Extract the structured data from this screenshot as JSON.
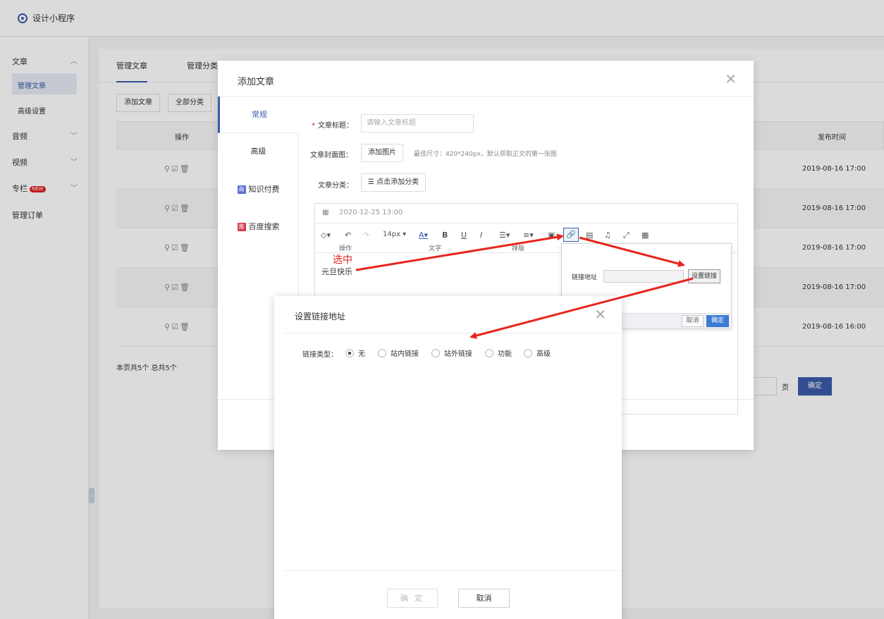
{
  "app": {
    "title": "设计小程序"
  },
  "sidebar": {
    "groups": [
      {
        "label": "文章",
        "chevron": "^"
      },
      {
        "label": "音频",
        "chevron": "v"
      },
      {
        "label": "视频",
        "chevron": "v"
      },
      {
        "label": "专栏",
        "chevron": "v",
        "badge": "NEW"
      },
      {
        "label": "管理订单"
      }
    ],
    "sub_items": [
      {
        "label": "管理文章",
        "active": true
      },
      {
        "label": "高级设置",
        "active": false
      }
    ]
  },
  "main": {
    "tabs": [
      {
        "label": "管理文章"
      },
      {
        "label": "管理分类"
      }
    ],
    "actions": {
      "add": "添加文章",
      "filter": "全部分类"
    },
    "table": {
      "headers": [
        "操作",
        "发布时间"
      ],
      "rows": [
        {
          "date": "2019-08-16 17:00"
        },
        {
          "date": "2019-08-16 17:00"
        },
        {
          "date": "2019-08-16 17:00"
        },
        {
          "date": "2019-08-16 17:00"
        },
        {
          "date": "2019-08-16 16:00"
        }
      ]
    },
    "pagination": {
      "info": "本页共5个  总共5个",
      "unit": "页",
      "confirm": "确定"
    }
  },
  "article_modal": {
    "title": "添加文章",
    "side_tabs": [
      {
        "label": "常规",
        "active": true
      },
      {
        "label": "高级"
      },
      {
        "label": "知识付费",
        "icon_text": "商",
        "icon_color": "#5b6fd6"
      },
      {
        "label": "百度搜索",
        "icon_text": "推",
        "icon_color": "#d63a4a"
      }
    ],
    "form": {
      "title_label": "文章标题：",
      "title_placeholder": "请输入文章标题",
      "cover_label": "文章封面图：",
      "cover_button": "添加图片",
      "cover_hint": "最佳尺寸：420*240px，默认获取正文的第一张图",
      "category_label": "文章分类：",
      "category_button": "点击添加分类"
    },
    "editor": {
      "date": "2020-12-25 13:00",
      "font_size": "14px",
      "captions": {
        "ops": "操作",
        "text": "文字",
        "layout": "排版"
      },
      "content": "元旦快乐"
    },
    "link_popover": {
      "address_label": "链接地址",
      "set_button": "设置链接",
      "cancel": "取消",
      "ok": "确定"
    }
  },
  "link_dialog": {
    "title": "设置链接地址",
    "type_label": "链接类型：",
    "options": [
      {
        "label": "无",
        "selected": true
      },
      {
        "label": "站内链接",
        "selected": false
      },
      {
        "label": "站外链接",
        "selected": false
      },
      {
        "label": "功能",
        "selected": false
      },
      {
        "label": "高级",
        "selected": false
      }
    ],
    "ok": "确 定",
    "cancel": "取消"
  },
  "annotation": {
    "text": "选中",
    "color": "#e02020"
  }
}
